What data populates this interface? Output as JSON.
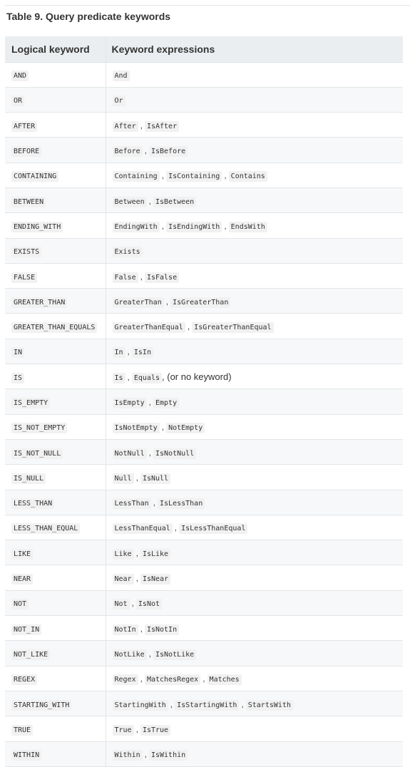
{
  "table": {
    "caption": "Table 9. Query predicate keywords",
    "headers": [
      "Logical keyword",
      "Keyword expressions"
    ],
    "rows": [
      {
        "keyword": "AND",
        "expressions": [
          "And"
        ],
        "note": ""
      },
      {
        "keyword": "OR",
        "expressions": [
          "Or"
        ],
        "note": ""
      },
      {
        "keyword": "AFTER",
        "expressions": [
          "After",
          "IsAfter"
        ],
        "note": ""
      },
      {
        "keyword": "BEFORE",
        "expressions": [
          "Before",
          "IsBefore"
        ],
        "note": ""
      },
      {
        "keyword": "CONTAINING",
        "expressions": [
          "Containing",
          "IsContaining",
          "Contains"
        ],
        "note": ""
      },
      {
        "keyword": "BETWEEN",
        "expressions": [
          "Between",
          "IsBetween"
        ],
        "note": ""
      },
      {
        "keyword": "ENDING_WITH",
        "expressions": [
          "EndingWith",
          "IsEndingWith",
          "EndsWith"
        ],
        "note": ""
      },
      {
        "keyword": "EXISTS",
        "expressions": [
          "Exists"
        ],
        "note": ""
      },
      {
        "keyword": "FALSE",
        "expressions": [
          "False",
          "IsFalse"
        ],
        "note": ""
      },
      {
        "keyword": "GREATER_THAN",
        "expressions": [
          "GreaterThan",
          "IsGreaterThan"
        ],
        "note": ""
      },
      {
        "keyword": "GREATER_THAN_EQUALS",
        "expressions": [
          "GreaterThanEqual",
          "IsGreaterThanEqual"
        ],
        "note": ""
      },
      {
        "keyword": "IN",
        "expressions": [
          "In",
          "IsIn"
        ],
        "note": ""
      },
      {
        "keyword": "IS",
        "expressions": [
          "Is",
          "Equals"
        ],
        "note": ", (or no keyword)"
      },
      {
        "keyword": "IS_EMPTY",
        "expressions": [
          "IsEmpty",
          "Empty"
        ],
        "note": ""
      },
      {
        "keyword": "IS_NOT_EMPTY",
        "expressions": [
          "IsNotEmpty",
          "NotEmpty"
        ],
        "note": ""
      },
      {
        "keyword": "IS_NOT_NULL",
        "expressions": [
          "NotNull",
          "IsNotNull"
        ],
        "note": ""
      },
      {
        "keyword": "IS_NULL",
        "expressions": [
          "Null",
          "IsNull"
        ],
        "note": ""
      },
      {
        "keyword": "LESS_THAN",
        "expressions": [
          "LessThan",
          "IsLessThan"
        ],
        "note": ""
      },
      {
        "keyword": "LESS_THAN_EQUAL",
        "expressions": [
          "LessThanEqual",
          "IsLessThanEqual"
        ],
        "note": ""
      },
      {
        "keyword": "LIKE",
        "expressions": [
          "Like",
          "IsLike"
        ],
        "note": ""
      },
      {
        "keyword": "NEAR",
        "expressions": [
          "Near",
          "IsNear"
        ],
        "note": ""
      },
      {
        "keyword": "NOT",
        "expressions": [
          "Not",
          "IsNot"
        ],
        "note": ""
      },
      {
        "keyword": "NOT_IN",
        "expressions": [
          "NotIn",
          "IsNotIn"
        ],
        "note": ""
      },
      {
        "keyword": "NOT_LIKE",
        "expressions": [
          "NotLike",
          "IsNotLike"
        ],
        "note": ""
      },
      {
        "keyword": "REGEX",
        "expressions": [
          "Regex",
          "MatchesRegex",
          "Matches"
        ],
        "note": ""
      },
      {
        "keyword": "STARTING_WITH",
        "expressions": [
          "StartingWith",
          "IsStartingWith",
          "StartsWith"
        ],
        "note": ""
      },
      {
        "keyword": "TRUE",
        "expressions": [
          "True",
          "IsTrue"
        ],
        "note": ""
      },
      {
        "keyword": "WITHIN",
        "expressions": [
          "Within",
          "IsWithin"
        ],
        "note": ""
      }
    ]
  }
}
